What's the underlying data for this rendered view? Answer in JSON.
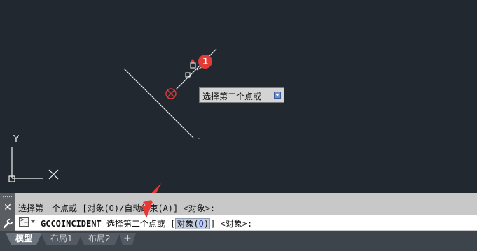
{
  "tooltip": {
    "text": "选择第二个点或"
  },
  "annotation": {
    "step_badge": "1"
  },
  "command_line": {
    "history": "选择第一个点或 [对象(O)/自动约束(A)] <对象>:",
    "command_name": "GCCOINCIDENT",
    "prompt_text": " 选择第二个点或 [",
    "option_label": "对象(",
    "option_key": "O",
    "option_close": ")",
    "prompt_suffix": "] <对象>:"
  },
  "tabs": [
    {
      "label": "模型",
      "active": true
    },
    {
      "label": "布局1",
      "active": false
    },
    {
      "label": "布局2",
      "active": false
    }
  ],
  "add_tab_label": "+",
  "ucs": {
    "y_label": "Y"
  },
  "colors": {
    "background": "#212830",
    "badge": "#e53935",
    "marker": "#e53935",
    "arrow": "#e53935"
  }
}
